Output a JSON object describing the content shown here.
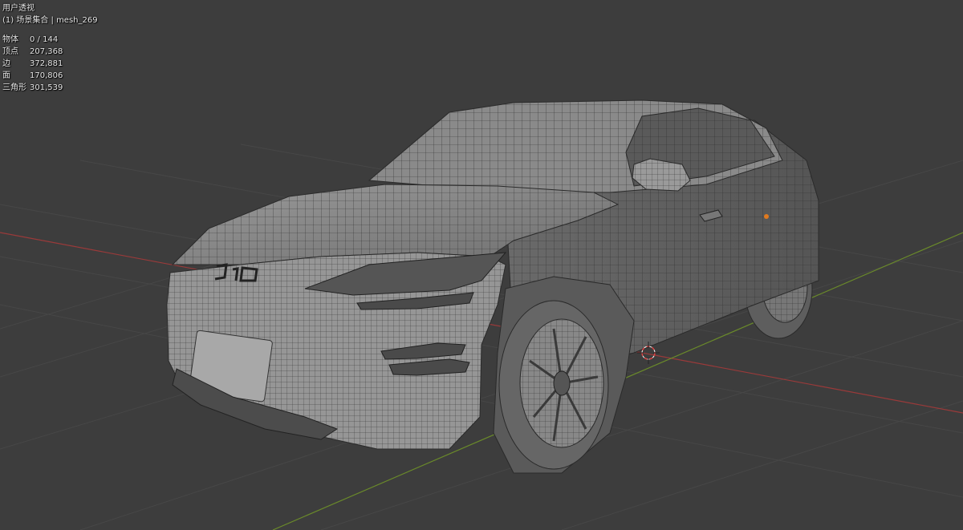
{
  "viewport": {
    "view_name": "用户透视",
    "collection_info": "(1) 场景集合 | mesh_269"
  },
  "stats": [
    {
      "label": "物体",
      "value": "0 / 144"
    },
    {
      "label": "顶点",
      "value": "207,368"
    },
    {
      "label": "边",
      "value": "372,881"
    },
    {
      "label": "面",
      "value": "170,806"
    },
    {
      "label": "三角形",
      "value": "301,539"
    }
  ],
  "colors": {
    "background": "#3d3d3d",
    "grid": "#474747",
    "x_axis": "#9a3a3a",
    "y_axis": "#6a8a2a",
    "mesh": "#8f8f8f",
    "wire": "#2c2c2c"
  }
}
